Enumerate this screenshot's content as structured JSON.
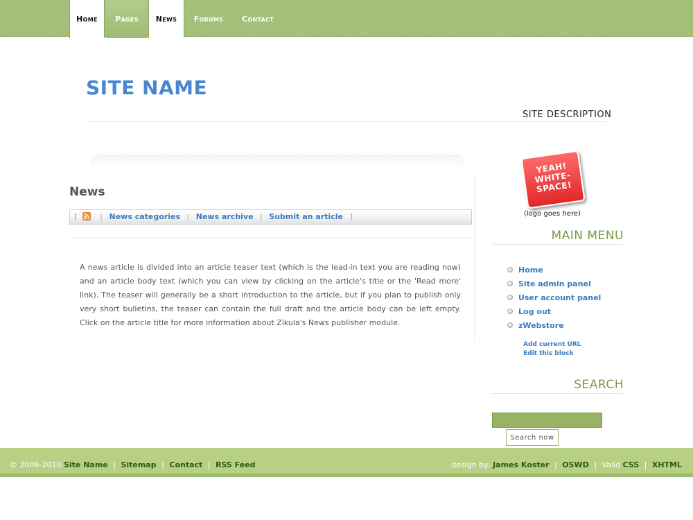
{
  "nav": {
    "tabs": [
      {
        "label": "Home",
        "active": true
      },
      {
        "label": "Pages",
        "active": false
      },
      {
        "label": "News",
        "active": true
      },
      {
        "label": "Forums",
        "active": false
      },
      {
        "label": "Contact",
        "active": false
      }
    ]
  },
  "header": {
    "site_name": "SITE NAME",
    "site_description": "SITE DESCRIPTION"
  },
  "main": {
    "title": "News",
    "news_nav": {
      "open_bracket": "[",
      "close_bracket": "]",
      "separator": "|",
      "rss_icon": "rss-feed-icon",
      "links": [
        "News categories",
        "News archive",
        "Submit an article"
      ]
    },
    "article_text": "A news article is divided into an article teaser text (which is the lead-in text you are reading now) and an article body text (which you can view by clicking on the article's title or the 'Read more' link). The teaser will generally be a short introduction to the article, but if you plan to publish only very short bulletins, the teaser can contain the full draft and the article body can be left empty. Click on the article title for more information about Zikula's News publisher module."
  },
  "sidebar": {
    "logo": {
      "sticker_lines": [
        "YEAH!",
        "WHITE-",
        "SPACE!"
      ],
      "caption": "(logo goes here)"
    },
    "main_menu": {
      "title": "MAIN MENU",
      "items": [
        "Home",
        "Site admin panel",
        "User account panel",
        "Log out",
        "zWebstore"
      ],
      "block_links": [
        "Add current URL",
        "Edit this block"
      ]
    },
    "search": {
      "title": "SEARCH",
      "input_value": "",
      "button_label": "Search now"
    }
  },
  "footer": {
    "copyright": "© 2006-2010",
    "left_links": [
      "Site Name",
      "Sitemap",
      "Contact",
      "RSS Feed"
    ],
    "design_by_label": "design by:",
    "designer": "James Koster",
    "oswd": "OSWD",
    "valid_label": "Valid",
    "valid_links": [
      "CSS",
      "XHTML"
    ],
    "separator": "|"
  },
  "colors": {
    "accent_green": "#9dbb72",
    "link_blue": "#3a7bbf",
    "site_name_blue": "#4a86d0",
    "footer_green": "#b8d084",
    "sticker_red": "#e02828"
  }
}
